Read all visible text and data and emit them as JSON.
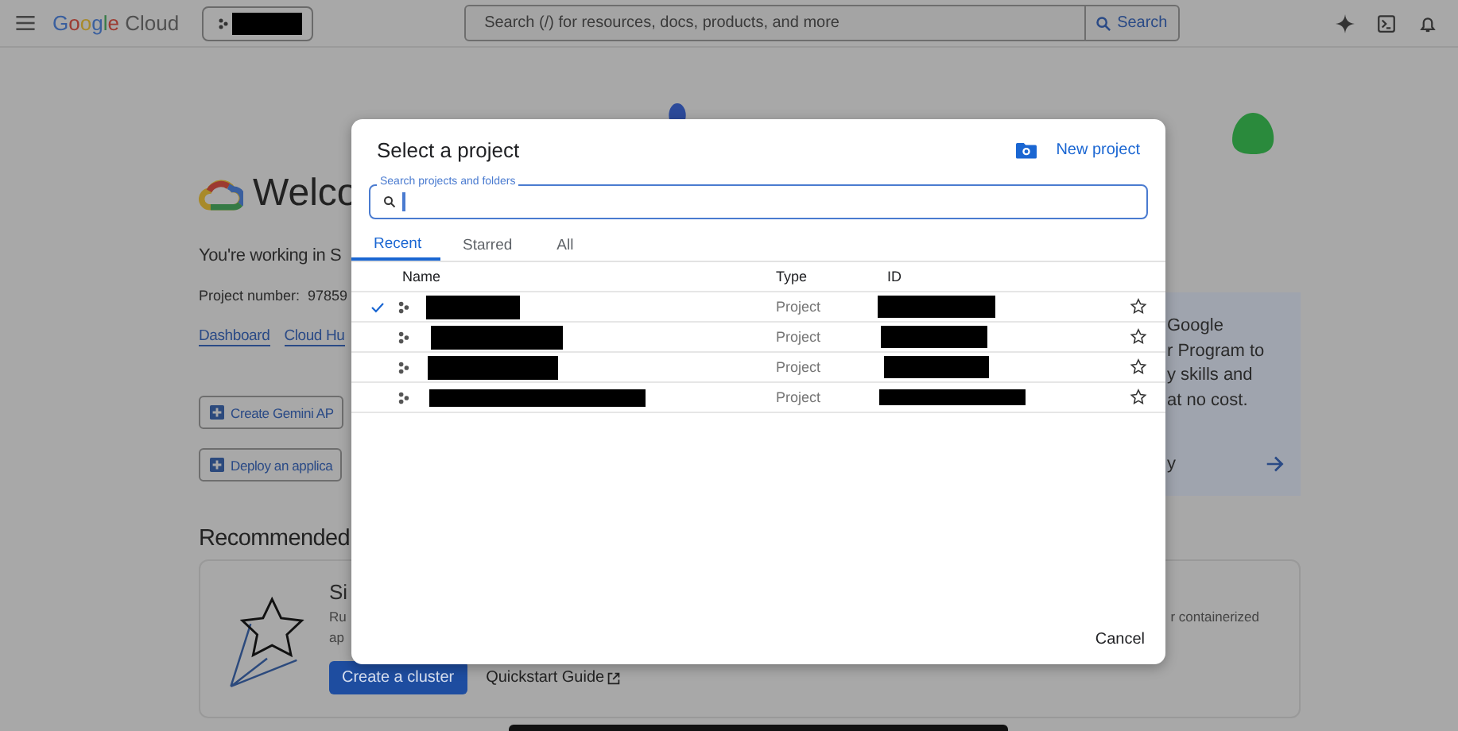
{
  "top_bar": {
    "logo": "Google Cloud",
    "project_picker": {
      "redacted": true
    },
    "search": {
      "placeholder": "Search (/) for resources, docs, products, and more",
      "button": "Search"
    }
  },
  "welcome": {
    "title": "Welco",
    "working_in": "You're working in S",
    "project_number_label": "Project number:",
    "project_number": "97859",
    "links": [
      "Dashboard",
      "Cloud Hu"
    ],
    "actions": [
      "Create Gemini AP",
      "Deploy an applica"
    ]
  },
  "promo": {
    "lines": [
      "Google",
      "r Program to",
      "y skills and",
      "at no cost."
    ],
    "link": "y"
  },
  "recommended": {
    "title": "Recommended",
    "card": {
      "title": "Si",
      "lines": [
        "Ru",
        "ap"
      ],
      "right_text": "r containerized",
      "primary_button": "Create a cluster",
      "link": "Quickstart Guide"
    }
  },
  "dialog": {
    "title": "Select a project",
    "new_project": "New project",
    "search": {
      "label": "Search projects and folders"
    },
    "tabs": [
      {
        "label": "Recent",
        "selected": true
      },
      {
        "label": "Starred",
        "selected": false
      },
      {
        "label": "All",
        "selected": false
      }
    ],
    "columns": [
      "Name",
      "Type",
      "ID"
    ],
    "rows": [
      {
        "selected": true,
        "name_redacted": true,
        "type": "Project",
        "id_redacted": true,
        "starred": false
      },
      {
        "selected": false,
        "name_redacted": true,
        "type": "Project",
        "id_redacted": true,
        "starred": false
      },
      {
        "selected": false,
        "name_redacted": true,
        "type": "Project",
        "id_redacted": true,
        "starred": false
      },
      {
        "selected": false,
        "name_redacted": true,
        "type": "Project",
        "id_redacted": true,
        "starred": false
      }
    ],
    "cancel": "Cancel"
  }
}
